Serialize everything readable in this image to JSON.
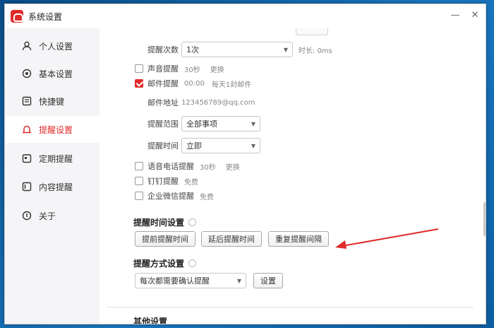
{
  "window": {
    "title": "系统设置"
  },
  "sidebar": {
    "items": [
      {
        "label": "个人设置",
        "icon": "user-icon"
      },
      {
        "label": "基本设置",
        "icon": "settings-circle-icon"
      },
      {
        "label": "快捷键",
        "icon": "keyboard-icon"
      },
      {
        "label": "提醒设置",
        "icon": "bell-icon",
        "active": true
      },
      {
        "label": "定期提醒",
        "icon": "calendar-icon"
      },
      {
        "label": "内容提醒",
        "icon": "document-icon"
      },
      {
        "label": "关于",
        "icon": "info-icon"
      }
    ]
  },
  "content": {
    "remind_times": {
      "label": "提醒次数",
      "value": "1次",
      "suffix": "时长: 0ms"
    },
    "sound": {
      "label": "声音提醒",
      "value": "30秒",
      "hint": "更换",
      "checked": false
    },
    "email": {
      "label": "邮件提醒",
      "value": "00:00",
      "hint": "每天1封邮件",
      "checked": true
    },
    "email_address": {
      "label": "邮件地址",
      "value": "123456789@qq.com"
    },
    "remind_range": {
      "label": "提醒范围",
      "value": "全部事项"
    },
    "remind_time": {
      "label": "提醒时间",
      "value": "立即"
    },
    "options": [
      {
        "label": "语音电话提醒",
        "value": "30秒",
        "hint": "更换",
        "checked": false
      },
      {
        "label": "钉钉提醒",
        "value": "免费",
        "checked": false
      },
      {
        "label": "企业微信提醒",
        "value": "免费",
        "checked": false
      }
    ],
    "sync_section": {
      "title": "提醒时间设置",
      "buttons": [
        "提前提醒时间",
        "延后提醒时间",
        "重复提醒间隔"
      ]
    },
    "schedule_section": {
      "title": "提醒方式设置",
      "select_value": "每次都需要确认提醒",
      "confirm_label": "设置"
    },
    "bottom_section": {
      "title": "其他设置"
    }
  },
  "colors": {
    "accent": "#e02b2b",
    "arrow": "#e02b2b"
  }
}
